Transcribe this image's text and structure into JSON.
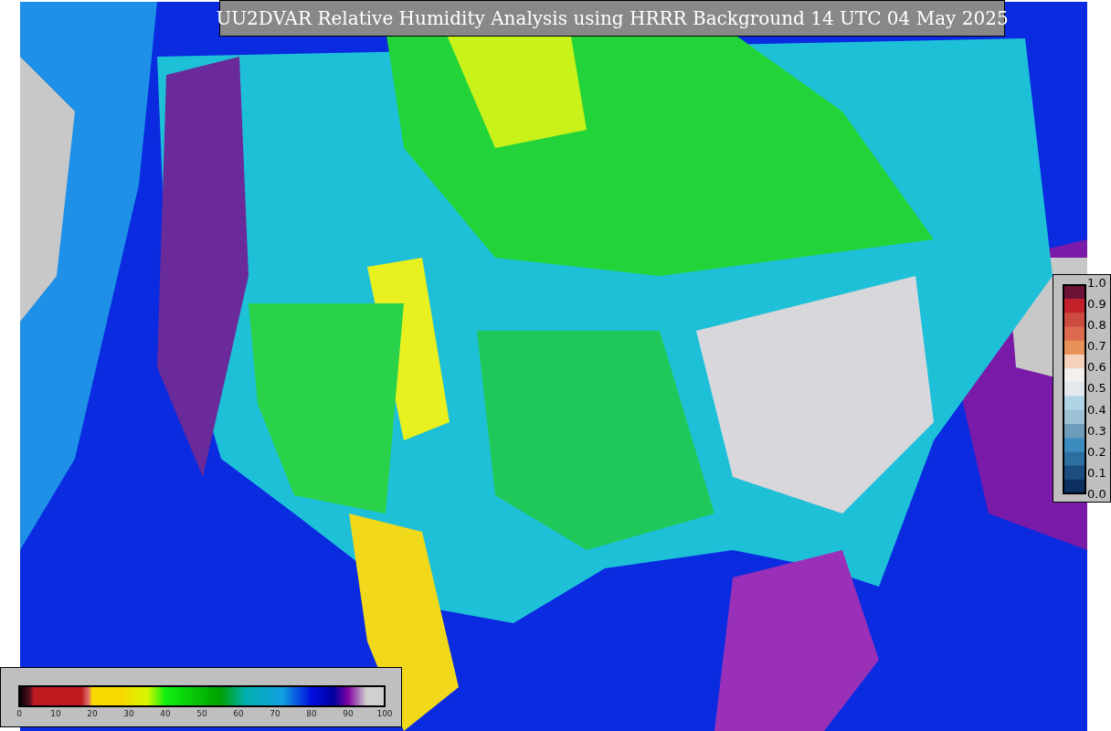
{
  "title": "UU2DVAR Relative Humidity Analysis using HRRR Background 14 UTC 04 May 2025",
  "humidity_colorbar": {
    "ticks": [
      "0",
      "10",
      "20",
      "30",
      "40",
      "50",
      "60",
      "70",
      "80",
      "90",
      "100"
    ]
  },
  "station_colorbar": {
    "ticks": [
      "1.0",
      "0.9",
      "0.8",
      "0.7",
      "0.6",
      "0.5",
      "0.4",
      "0.3",
      "0.2",
      "0.1",
      "0.0"
    ]
  }
}
